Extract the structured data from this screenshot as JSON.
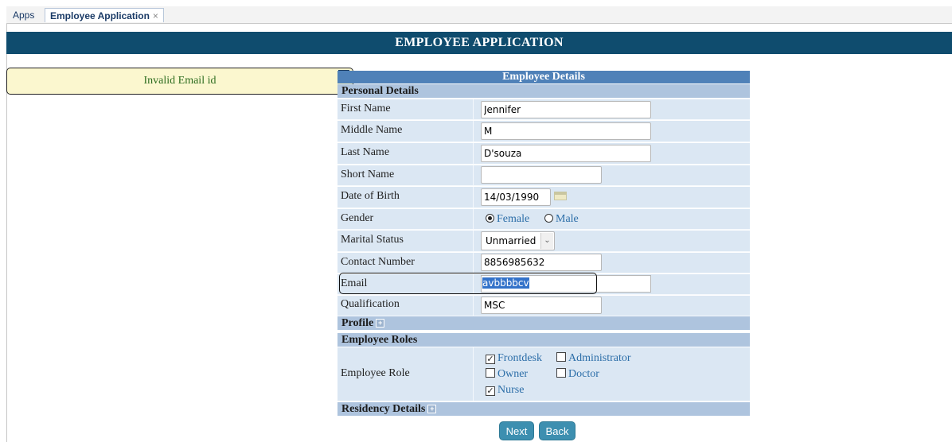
{
  "tabs": {
    "apps": "Apps",
    "active": "Employee Application",
    "close": "×"
  },
  "header": "EMPLOYEE APPLICATION",
  "error": {
    "message": "Invalid Email id",
    "close": "x"
  },
  "form": {
    "caption": "Employee Details",
    "personal_section": "Personal Details",
    "first_name_label": "First Name",
    "first_name": "Jennifer",
    "middle_name_label": "Middle Name",
    "middle_name": "M",
    "last_name_label": "Last Name",
    "last_name": "D'souza",
    "short_name_label": "Short Name",
    "short_name": "",
    "dob_label": "Date of Birth",
    "dob": "14/03/1990",
    "gender_label": "Gender",
    "gender_female": "Female",
    "gender_male": "Male",
    "gender_selected": "Female",
    "marital_label": "Marital Status",
    "marital": "Unmarried",
    "contact_label": "Contact Number",
    "contact": "8856985632",
    "email_label": "Email",
    "email": "avbbbbcv",
    "qualification_label": "Qualification",
    "qualification": "MSC",
    "profile_section": "Profile",
    "roles_section": "Employee Roles",
    "role_label": "Employee Role",
    "roles": [
      {
        "label": "Frontdesk",
        "checked": true
      },
      {
        "label": "Administrator",
        "checked": false
      },
      {
        "label": "Owner",
        "checked": false
      },
      {
        "label": "Doctor",
        "checked": false
      },
      {
        "label": "Nurse",
        "checked": true
      }
    ],
    "residency_section": "Residency Details"
  },
  "buttons": {
    "next": "Next",
    "back": "Back"
  },
  "colors": {
    "header_bg": "#0f4c6e",
    "section_bg": "#aec4de",
    "row_bg": "#dbe7f3",
    "caption_bg": "#4f81b8",
    "button_bg": "#3d8fb0",
    "error_bg": "#fbf7cf"
  }
}
